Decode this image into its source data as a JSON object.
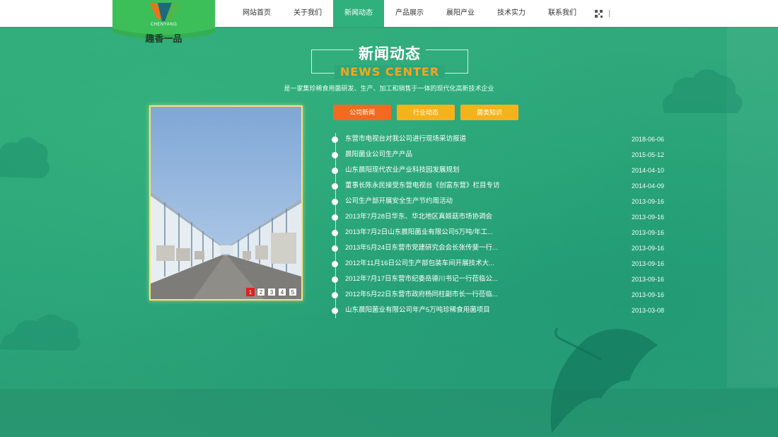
{
  "nav": {
    "items": [
      {
        "label": "网站首页",
        "active": false
      },
      {
        "label": "关于我们",
        "active": false
      },
      {
        "label": "新闻动态",
        "active": true
      },
      {
        "label": "产品展示",
        "active": false
      },
      {
        "label": "晨阳产业",
        "active": false
      },
      {
        "label": "技术实力",
        "active": false
      },
      {
        "label": "联系我们",
        "active": false
      }
    ],
    "qr_icon": "qr-code-icon"
  },
  "logo": {
    "brand_text": "CHENYANG",
    "slogan": "趣香一品"
  },
  "section": {
    "title_cn": "新闻动态",
    "title_en": "NEWS CENTER",
    "subtitle": "是一家集珍稀食用菌研发、生产、加工和销售于一体的现代化高新技术企业"
  },
  "tabs": [
    {
      "label": "公司新闻"
    },
    {
      "label": "行业动态"
    },
    {
      "label": "菌类知识"
    }
  ],
  "photo": {
    "pager": [
      "1",
      "2",
      "3",
      "4",
      "5"
    ],
    "active_page": "1"
  },
  "news": [
    {
      "title": "东营市电视台对我公司进行现场采访报道",
      "date": "2018-06-06"
    },
    {
      "title": "晨阳菌业公司生产产品",
      "date": "2015-05-12"
    },
    {
      "title": "山东晨阳现代农业产业科技园发展规划",
      "date": "2014-04-10"
    },
    {
      "title": "董事长陈永民接受东营电视台《创富东营》栏目专访",
      "date": "2014-04-09"
    },
    {
      "title": "公司生产部开展安全生产节约周活动",
      "date": "2013-09-16"
    },
    {
      "title": "2013年7月28日华东、华北地区真姬菇市场协调会",
      "date": "2013-09-16"
    },
    {
      "title": "2013年7月2日山东晨阳菌业有限公司5万吨/年工...",
      "date": "2013-09-16"
    },
    {
      "title": "2013年5月24日东营市党建研究会会长张传斐一行...",
      "date": "2013-09-16"
    },
    {
      "title": "2012年11月16日公司生产部包装车间开展技术大...",
      "date": "2013-09-16"
    },
    {
      "title": "2012年7月17日东营市纪委岳德川书记一行莅临公...",
      "date": "2013-09-16"
    },
    {
      "title": "2012年5月22日东营市政府杨同柱副市长一行莅临...",
      "date": "2013-09-16"
    },
    {
      "title": "山东晨阳菌业有限公司年产5万吨珍稀食用菌项目",
      "date": "2013-03-08"
    }
  ],
  "colors": {
    "background": "#2ea77a",
    "nav_active": "#2fb07c",
    "tab_primary": "#f26a21",
    "tab_secondary": "#f6b21c",
    "title_en": "#f8a51c"
  }
}
